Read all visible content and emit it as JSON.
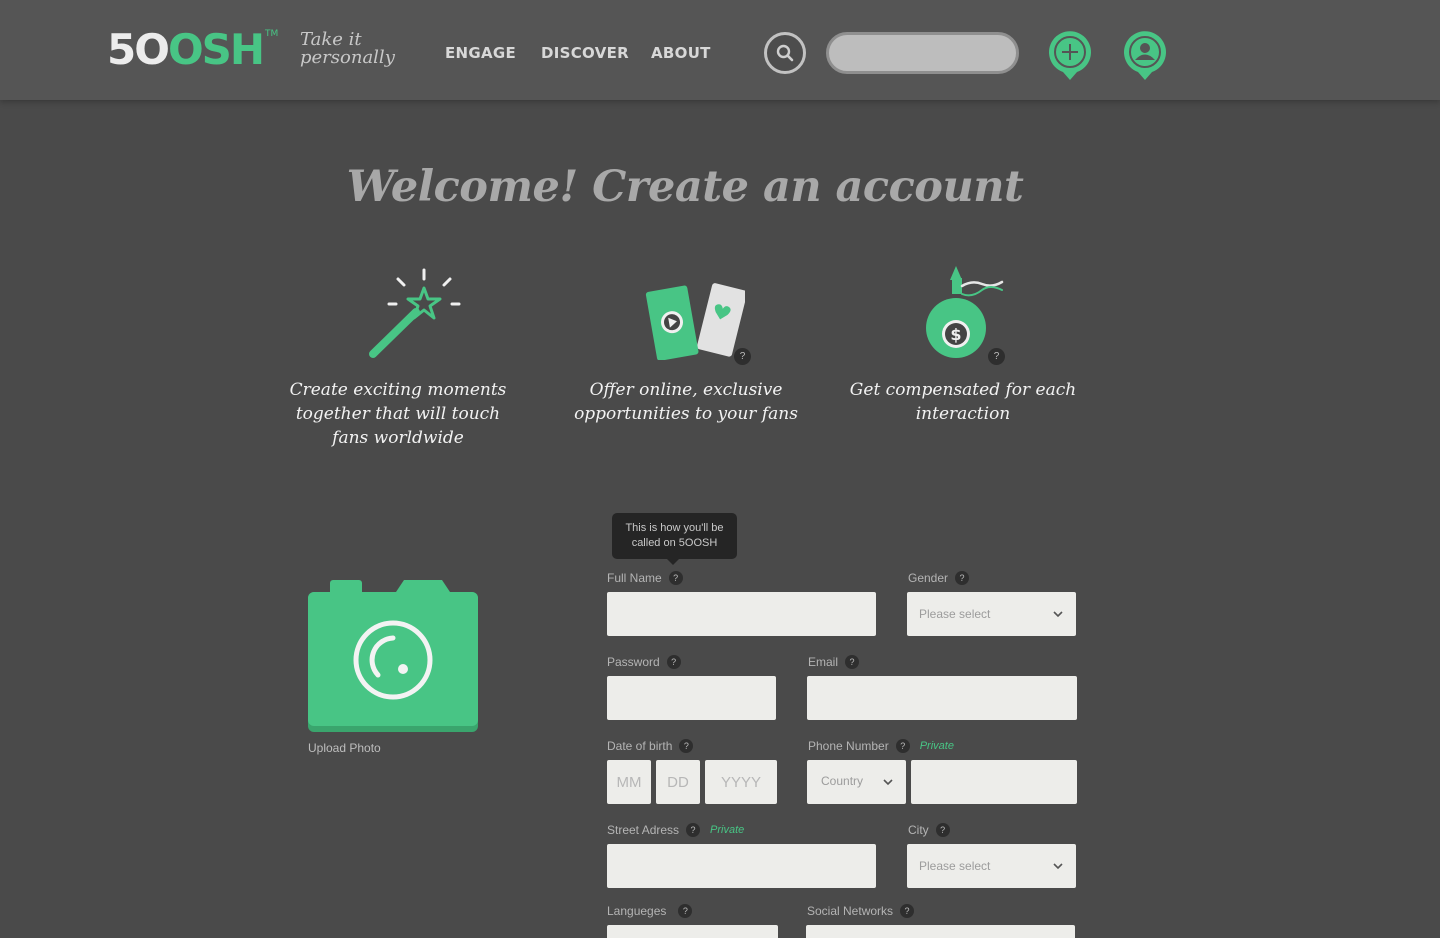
{
  "header": {
    "logo": {
      "part1": "5O",
      "part2": "OSH",
      "tm": "TM"
    },
    "tagline": {
      "line1": "Take it",
      "line2": "personally"
    },
    "nav": [
      {
        "label": "ENGAGE"
      },
      {
        "label": "DISCOVER"
      },
      {
        "label": "ABOUT"
      }
    ],
    "search_placeholder": ""
  },
  "page": {
    "title": "Welcome!  Create an account"
  },
  "features": [
    {
      "icon": "magic-wand-icon",
      "text": "Create exciting moments together that will touch fans worldwide",
      "help": ""
    },
    {
      "icon": "tickets-icon",
      "text": "Offer online, exclusive opportunities to your fans",
      "help": "?"
    },
    {
      "icon": "money-bag-icon",
      "text": "Get compensated for each interaction",
      "help": "?"
    }
  ],
  "tooltip": {
    "text": "This is how you'll be called on 5OOSH"
  },
  "upload": {
    "label": "Upload Photo"
  },
  "form": {
    "help": "?",
    "private_label": "Private",
    "full_name": {
      "label": "Full Name",
      "value": ""
    },
    "gender": {
      "label": "Gender",
      "value": "Please select"
    },
    "password": {
      "label": "Password",
      "value": ""
    },
    "email": {
      "label": "Email",
      "value": ""
    },
    "dob": {
      "label": "Date of birth",
      "mm": "MM",
      "dd": "DD",
      "yyyy": "YYYY"
    },
    "phone": {
      "label": "Phone Number",
      "country": "Country",
      "value": ""
    },
    "street": {
      "label": "Street Adress",
      "value": ""
    },
    "city": {
      "label": "City",
      "value": "Please select"
    },
    "languages": {
      "label": "Langueges"
    },
    "social": {
      "label": "Social Networks"
    }
  },
  "colors": {
    "accent": "#48c585",
    "background": "#4a4a4a",
    "header": "#555555",
    "field": "#ededea"
  }
}
